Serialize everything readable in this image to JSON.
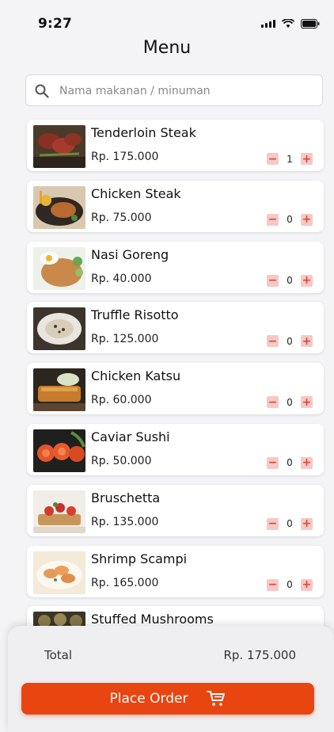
{
  "status_bar": {
    "time": "9:27"
  },
  "header": {
    "title": "Menu"
  },
  "search": {
    "placeholder": "Nama makanan / minuman"
  },
  "menu": {
    "items": [
      {
        "name": "Tenderloin Steak",
        "price": "Rp. 175.000",
        "quantity": "1"
      },
      {
        "name": "Chicken Steak",
        "price": "Rp. 75.000",
        "quantity": "0"
      },
      {
        "name": "Nasi Goreng",
        "price": "Rp. 40.000",
        "quantity": "0"
      },
      {
        "name": "Truffle Risotto",
        "price": "Rp. 125.000",
        "quantity": "0"
      },
      {
        "name": "Chicken Katsu",
        "price": "Rp. 60.000",
        "quantity": "0"
      },
      {
        "name": "Caviar Sushi",
        "price": "Rp. 50.000",
        "quantity": "0"
      },
      {
        "name": "Bruschetta",
        "price": "Rp. 135.000",
        "quantity": "0"
      },
      {
        "name": "Shrimp Scampi",
        "price": "Rp. 165.000",
        "quantity": "0"
      },
      {
        "name": "Stuffed Mushrooms"
      }
    ],
    "decrement_symbol": "−",
    "increment_symbol": "+"
  },
  "footer": {
    "total_label": "Total",
    "total_value": "Rp. 175.000",
    "order_button_label": "Place Order",
    "cart_icon": "cart-icon"
  },
  "colors": {
    "accent": "#e84511",
    "stepper_bg": "#f6c9c6",
    "stepper_fg": "#d84a3a"
  }
}
